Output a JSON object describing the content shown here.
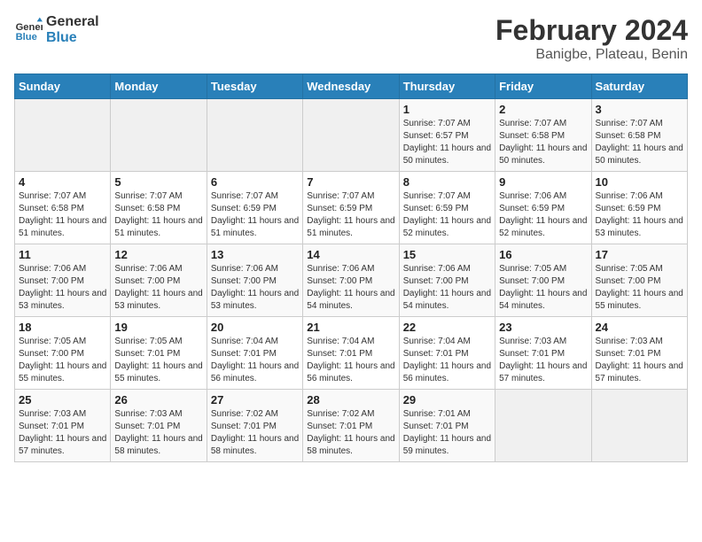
{
  "header": {
    "logo_line1": "General",
    "logo_line2": "Blue",
    "title": "February 2024",
    "subtitle": "Banigbe, Plateau, Benin"
  },
  "weekdays": [
    "Sunday",
    "Monday",
    "Tuesday",
    "Wednesday",
    "Thursday",
    "Friday",
    "Saturday"
  ],
  "weeks": [
    [
      {
        "day": "",
        "empty": true
      },
      {
        "day": "",
        "empty": true
      },
      {
        "day": "",
        "empty": true
      },
      {
        "day": "",
        "empty": true
      },
      {
        "day": "1",
        "sunrise": "7:07 AM",
        "sunset": "6:57 PM",
        "daylight": "11 hours and 50 minutes."
      },
      {
        "day": "2",
        "sunrise": "7:07 AM",
        "sunset": "6:58 PM",
        "daylight": "11 hours and 50 minutes."
      },
      {
        "day": "3",
        "sunrise": "7:07 AM",
        "sunset": "6:58 PM",
        "daylight": "11 hours and 50 minutes."
      }
    ],
    [
      {
        "day": "4",
        "sunrise": "7:07 AM",
        "sunset": "6:58 PM",
        "daylight": "11 hours and 51 minutes."
      },
      {
        "day": "5",
        "sunrise": "7:07 AM",
        "sunset": "6:58 PM",
        "daylight": "11 hours and 51 minutes."
      },
      {
        "day": "6",
        "sunrise": "7:07 AM",
        "sunset": "6:59 PM",
        "daylight": "11 hours and 51 minutes."
      },
      {
        "day": "7",
        "sunrise": "7:07 AM",
        "sunset": "6:59 PM",
        "daylight": "11 hours and 51 minutes."
      },
      {
        "day": "8",
        "sunrise": "7:07 AM",
        "sunset": "6:59 PM",
        "daylight": "11 hours and 52 minutes."
      },
      {
        "day": "9",
        "sunrise": "7:06 AM",
        "sunset": "6:59 PM",
        "daylight": "11 hours and 52 minutes."
      },
      {
        "day": "10",
        "sunrise": "7:06 AM",
        "sunset": "6:59 PM",
        "daylight": "11 hours and 53 minutes."
      }
    ],
    [
      {
        "day": "11",
        "sunrise": "7:06 AM",
        "sunset": "7:00 PM",
        "daylight": "11 hours and 53 minutes."
      },
      {
        "day": "12",
        "sunrise": "7:06 AM",
        "sunset": "7:00 PM",
        "daylight": "11 hours and 53 minutes."
      },
      {
        "day": "13",
        "sunrise": "7:06 AM",
        "sunset": "7:00 PM",
        "daylight": "11 hours and 53 minutes."
      },
      {
        "day": "14",
        "sunrise": "7:06 AM",
        "sunset": "7:00 PM",
        "daylight": "11 hours and 54 minutes."
      },
      {
        "day": "15",
        "sunrise": "7:06 AM",
        "sunset": "7:00 PM",
        "daylight": "11 hours and 54 minutes."
      },
      {
        "day": "16",
        "sunrise": "7:05 AM",
        "sunset": "7:00 PM",
        "daylight": "11 hours and 54 minutes."
      },
      {
        "day": "17",
        "sunrise": "7:05 AM",
        "sunset": "7:00 PM",
        "daylight": "11 hours and 55 minutes."
      }
    ],
    [
      {
        "day": "18",
        "sunrise": "7:05 AM",
        "sunset": "7:00 PM",
        "daylight": "11 hours and 55 minutes."
      },
      {
        "day": "19",
        "sunrise": "7:05 AM",
        "sunset": "7:01 PM",
        "daylight": "11 hours and 55 minutes."
      },
      {
        "day": "20",
        "sunrise": "7:04 AM",
        "sunset": "7:01 PM",
        "daylight": "11 hours and 56 minutes."
      },
      {
        "day": "21",
        "sunrise": "7:04 AM",
        "sunset": "7:01 PM",
        "daylight": "11 hours and 56 minutes."
      },
      {
        "day": "22",
        "sunrise": "7:04 AM",
        "sunset": "7:01 PM",
        "daylight": "11 hours and 56 minutes."
      },
      {
        "day": "23",
        "sunrise": "7:03 AM",
        "sunset": "7:01 PM",
        "daylight": "11 hours and 57 minutes."
      },
      {
        "day": "24",
        "sunrise": "7:03 AM",
        "sunset": "7:01 PM",
        "daylight": "11 hours and 57 minutes."
      }
    ],
    [
      {
        "day": "25",
        "sunrise": "7:03 AM",
        "sunset": "7:01 PM",
        "daylight": "11 hours and 57 minutes."
      },
      {
        "day": "26",
        "sunrise": "7:03 AM",
        "sunset": "7:01 PM",
        "daylight": "11 hours and 58 minutes."
      },
      {
        "day": "27",
        "sunrise": "7:02 AM",
        "sunset": "7:01 PM",
        "daylight": "11 hours and 58 minutes."
      },
      {
        "day": "28",
        "sunrise": "7:02 AM",
        "sunset": "7:01 PM",
        "daylight": "11 hours and 58 minutes."
      },
      {
        "day": "29",
        "sunrise": "7:01 AM",
        "sunset": "7:01 PM",
        "daylight": "11 hours and 59 minutes."
      },
      {
        "day": "",
        "empty": true
      },
      {
        "day": "",
        "empty": true
      }
    ]
  ]
}
